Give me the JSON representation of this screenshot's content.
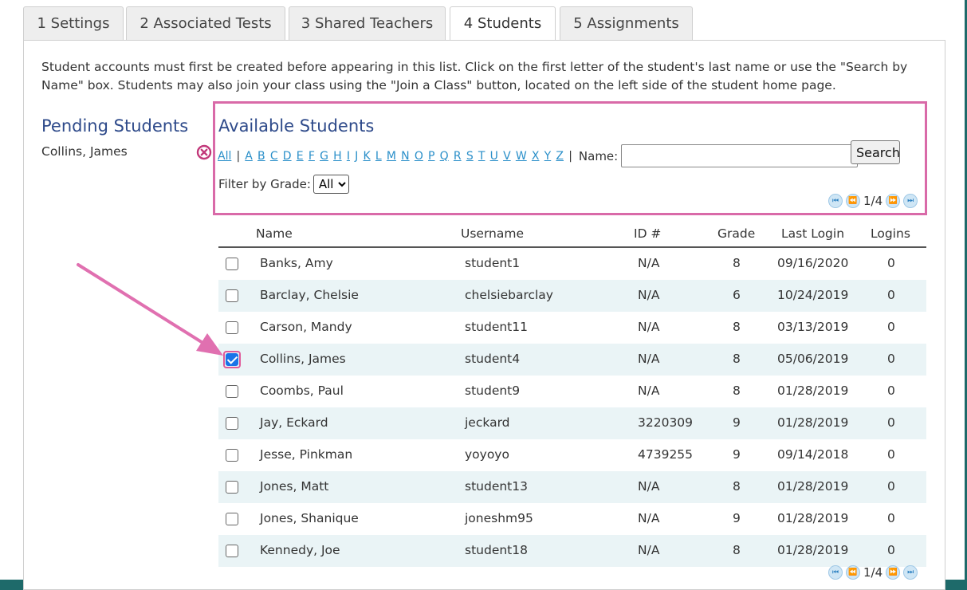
{
  "tabs": [
    {
      "label": "1 Settings",
      "active": false
    },
    {
      "label": "2 Associated Tests",
      "active": false
    },
    {
      "label": "3 Shared Teachers",
      "active": false
    },
    {
      "label": "4 Students",
      "active": true
    },
    {
      "label": "5 Assignments",
      "active": false
    }
  ],
  "intro_text": "Student accounts must first be created before appearing in this list. Click on the first letter of the student's last name or use the \"Search by Name\" box. Students may also join your class using the \"Join a Class\" button, located on the left side of the student home page.",
  "pending": {
    "title": "Pending Students",
    "students": [
      "Collins, James"
    ],
    "remove_icon": "remove-circle-icon"
  },
  "available": {
    "title": "Available Students",
    "letters": [
      "All",
      "A",
      "B",
      "C",
      "D",
      "E",
      "F",
      "G",
      "H",
      "I",
      "J",
      "K",
      "L",
      "M",
      "N",
      "O",
      "P",
      "Q",
      "R",
      "S",
      "T",
      "U",
      "V",
      "W",
      "X",
      "Y",
      "Z"
    ],
    "separator": "|",
    "name_label": "Name:",
    "name_value": "",
    "search_label": "Search",
    "filter_label": "Filter by Grade:",
    "grade_selected": "All",
    "page_indicator": "1/4"
  },
  "table": {
    "headers": {
      "name": "Name",
      "username": "Username",
      "id": "ID #",
      "grade": "Grade",
      "last_login": "Last Login",
      "logins": "Logins"
    },
    "rows": [
      {
        "name": "Banks, Amy",
        "username": "student1",
        "id": "N/A",
        "grade": "8",
        "last_login": "09/16/2020",
        "logins": "0",
        "checked": false
      },
      {
        "name": "Barclay, Chelsie",
        "username": "chelsiebarclay",
        "id": "N/A",
        "grade": "6",
        "last_login": "10/24/2019",
        "logins": "0",
        "checked": false
      },
      {
        "name": "Carson, Mandy",
        "username": "student11",
        "id": "N/A",
        "grade": "8",
        "last_login": "03/13/2019",
        "logins": "0",
        "checked": false
      },
      {
        "name": "Collins, James",
        "username": "student4",
        "id": "N/A",
        "grade": "8",
        "last_login": "05/06/2019",
        "logins": "0",
        "checked": true
      },
      {
        "name": "Coombs, Paul",
        "username": "student9",
        "id": "N/A",
        "grade": "8",
        "last_login": "01/28/2019",
        "logins": "0",
        "checked": false
      },
      {
        "name": "Jay, Eckard",
        "username": "jeckard",
        "id": "3220309",
        "grade": "9",
        "last_login": "01/28/2019",
        "logins": "0",
        "checked": false
      },
      {
        "name": "Jesse, Pinkman",
        "username": "yoyoyo",
        "id": "4739255",
        "grade": "9",
        "last_login": "09/14/2018",
        "logins": "0",
        "checked": false
      },
      {
        "name": "Jones, Matt",
        "username": "student13",
        "id": "N/A",
        "grade": "8",
        "last_login": "01/28/2019",
        "logins": "0",
        "checked": false
      },
      {
        "name": "Jones, Shanique",
        "username": "joneshm95",
        "id": "N/A",
        "grade": "9",
        "last_login": "01/28/2019",
        "logins": "0",
        "checked": false
      },
      {
        "name": "Kennedy, Joe",
        "username": "student18",
        "id": "N/A",
        "grade": "8",
        "last_login": "01/28/2019",
        "logins": "0",
        "checked": false
      }
    ]
  },
  "colors": {
    "highlight": "#d96aa8",
    "heading": "#2e4a8a",
    "link": "#2a8fc9",
    "alt_row": "#eaf4f6",
    "accent_checkbox": "#1a73e8"
  }
}
